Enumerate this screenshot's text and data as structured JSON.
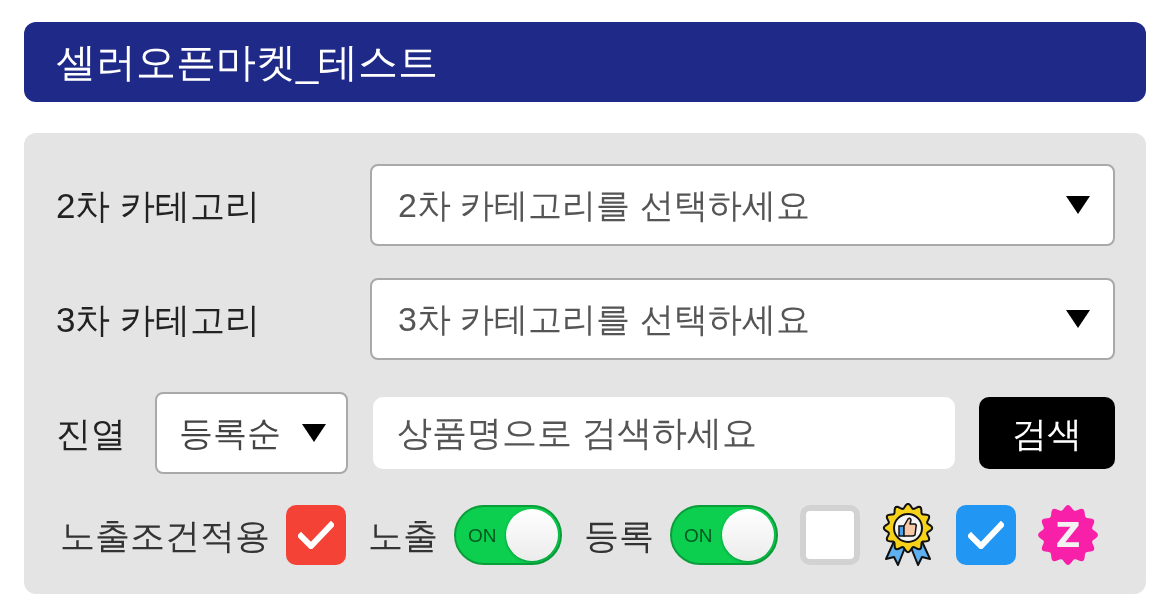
{
  "header": {
    "title": "셀러오픈마켓_테스트"
  },
  "category_filters": [
    {
      "label": "2차 카테고리",
      "placeholder": "2차 카테고리를 선택하세요"
    },
    {
      "label": "3차 카테고리",
      "placeholder": "3차 카테고리를 선택하세요"
    }
  ],
  "display": {
    "label": "진열",
    "sort": {
      "value": "등록순"
    }
  },
  "search": {
    "placeholder": "상품명으로 검색하세요",
    "button": "검색"
  },
  "options": [
    {
      "kind": "checkbox",
      "label": "노출조건적용",
      "checked": true,
      "color": "#f44336"
    },
    {
      "kind": "toggle",
      "label": "노출",
      "on": true,
      "text": "ON"
    },
    {
      "kind": "toggle",
      "label": "등록",
      "on": true,
      "text": "ON"
    },
    {
      "kind": "checkbox",
      "checked": false
    },
    {
      "kind": "award"
    },
    {
      "kind": "checkbox",
      "checked": true,
      "color": "#2196f3"
    },
    {
      "kind": "badge",
      "text": "Z",
      "color": "#f820a8"
    }
  ]
}
